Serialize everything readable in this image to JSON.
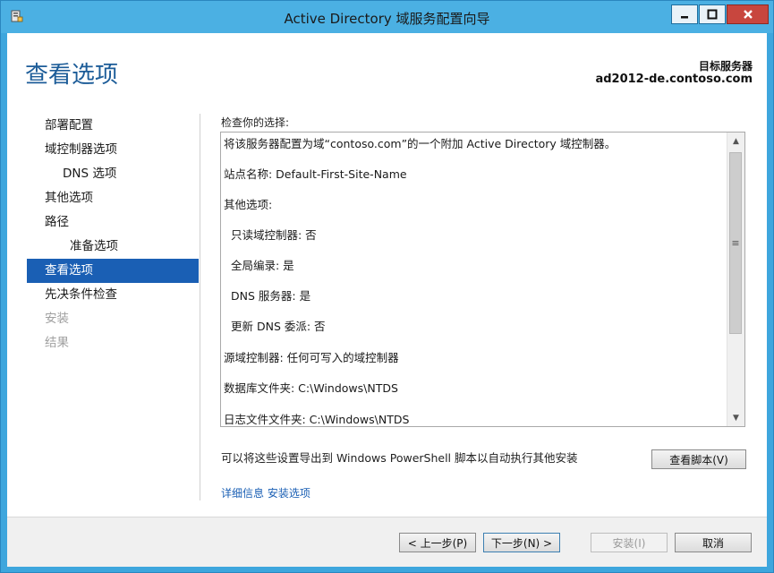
{
  "window": {
    "title": "Active Directory 域服务配置向导",
    "controls": {
      "minimize_icon": "minimize-icon",
      "maximize_icon": "maximize-icon",
      "close_icon": "close-icon"
    }
  },
  "header": {
    "page_title": "查看选项",
    "target_label": "目标服务器",
    "target_server": "ad2012-de.contoso.com"
  },
  "nav": {
    "items": [
      {
        "label": "部署配置",
        "state": "normal"
      },
      {
        "label": "域控制器选项",
        "state": "normal"
      },
      {
        "label": "DNS 选项",
        "state": "normal"
      },
      {
        "label": "其他选项",
        "state": "normal"
      },
      {
        "label": "路径",
        "state": "normal"
      },
      {
        "label": "准备选项",
        "state": "normal"
      },
      {
        "label": "查看选项",
        "state": "active"
      },
      {
        "label": "先决条件检查",
        "state": "normal"
      },
      {
        "label": "安装",
        "state": "disabled"
      },
      {
        "label": "结果",
        "state": "disabled"
      }
    ]
  },
  "review": {
    "label": "检查你的选择:",
    "lines": [
      "将该服务器配置为域“contoso.com”的一个附加 Active Directory 域控制器。",
      "站点名称: Default-First-Site-Name",
      "其他选项:",
      "只读域控制器: 否",
      "全局编录: 是",
      "DNS 服务器: 是",
      "更新 DNS 委派: 否",
      "源域控制器: 任何可写入的域控制器",
      "数据库文件夹: C:\\Windows\\NTDS",
      "日志文件文件夹: C:\\Windows\\NTDS"
    ]
  },
  "export": {
    "text": "可以将这些设置导出到 Windows PowerShell 脚本以自动执行其他安装",
    "view_script_label": "查看脚本(V)"
  },
  "more_info": {
    "prefix": "详细信息",
    "link": "安装选项"
  },
  "footer": {
    "prev_label": "< 上一步(P)",
    "next_label": "下一步(N) >",
    "install_label": "安装(I)",
    "cancel_label": "取消"
  },
  "colors": {
    "titlebar": "#4bb0e3",
    "accent": "#1a5fb4",
    "page_title": "#1c5c98"
  }
}
